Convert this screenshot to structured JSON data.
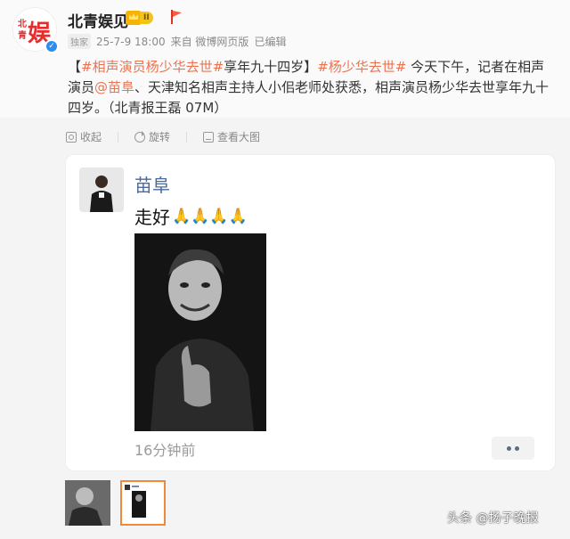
{
  "account": {
    "name": "北青娱见",
    "vip_level": "II",
    "exclusive_badge": "独家",
    "timestamp": "25-7-9 18:00",
    "source": "来自 微博网页版",
    "edited": "已编辑"
  },
  "post": {
    "bracket_open": "【",
    "tag1": "#相声演员杨少华去世#",
    "after_tag1": "享年九十四岁",
    "bracket_close": "】",
    "tag2": "#杨少华去世#",
    "text1": " 今天下午，记者在相声演员",
    "mention": "@苗阜",
    "text2": "、天津知名相声主持人小佀老师处获悉，相声演员杨少华去世享年九十四岁。（北青报王磊 07M）"
  },
  "actions": {
    "collapse": "收起",
    "rotate": "旋转",
    "view_large": "查看大图"
  },
  "embedded_post": {
    "name": "苗阜",
    "text": "走好",
    "emoji": "🙏🙏🙏🙏",
    "time": "16分钟前"
  },
  "icons": {
    "avatar": "beiqing-yu-logo",
    "collapse": "collapse-icon",
    "rotate": "rotate-icon",
    "view_large": "view-large-icon",
    "more": "more-dots-icon"
  },
  "watermark": "头条 @扬子晚报",
  "colors": {
    "accent": "#eb7350",
    "link": "#4a69a0",
    "verified": "#2e8cf0"
  }
}
